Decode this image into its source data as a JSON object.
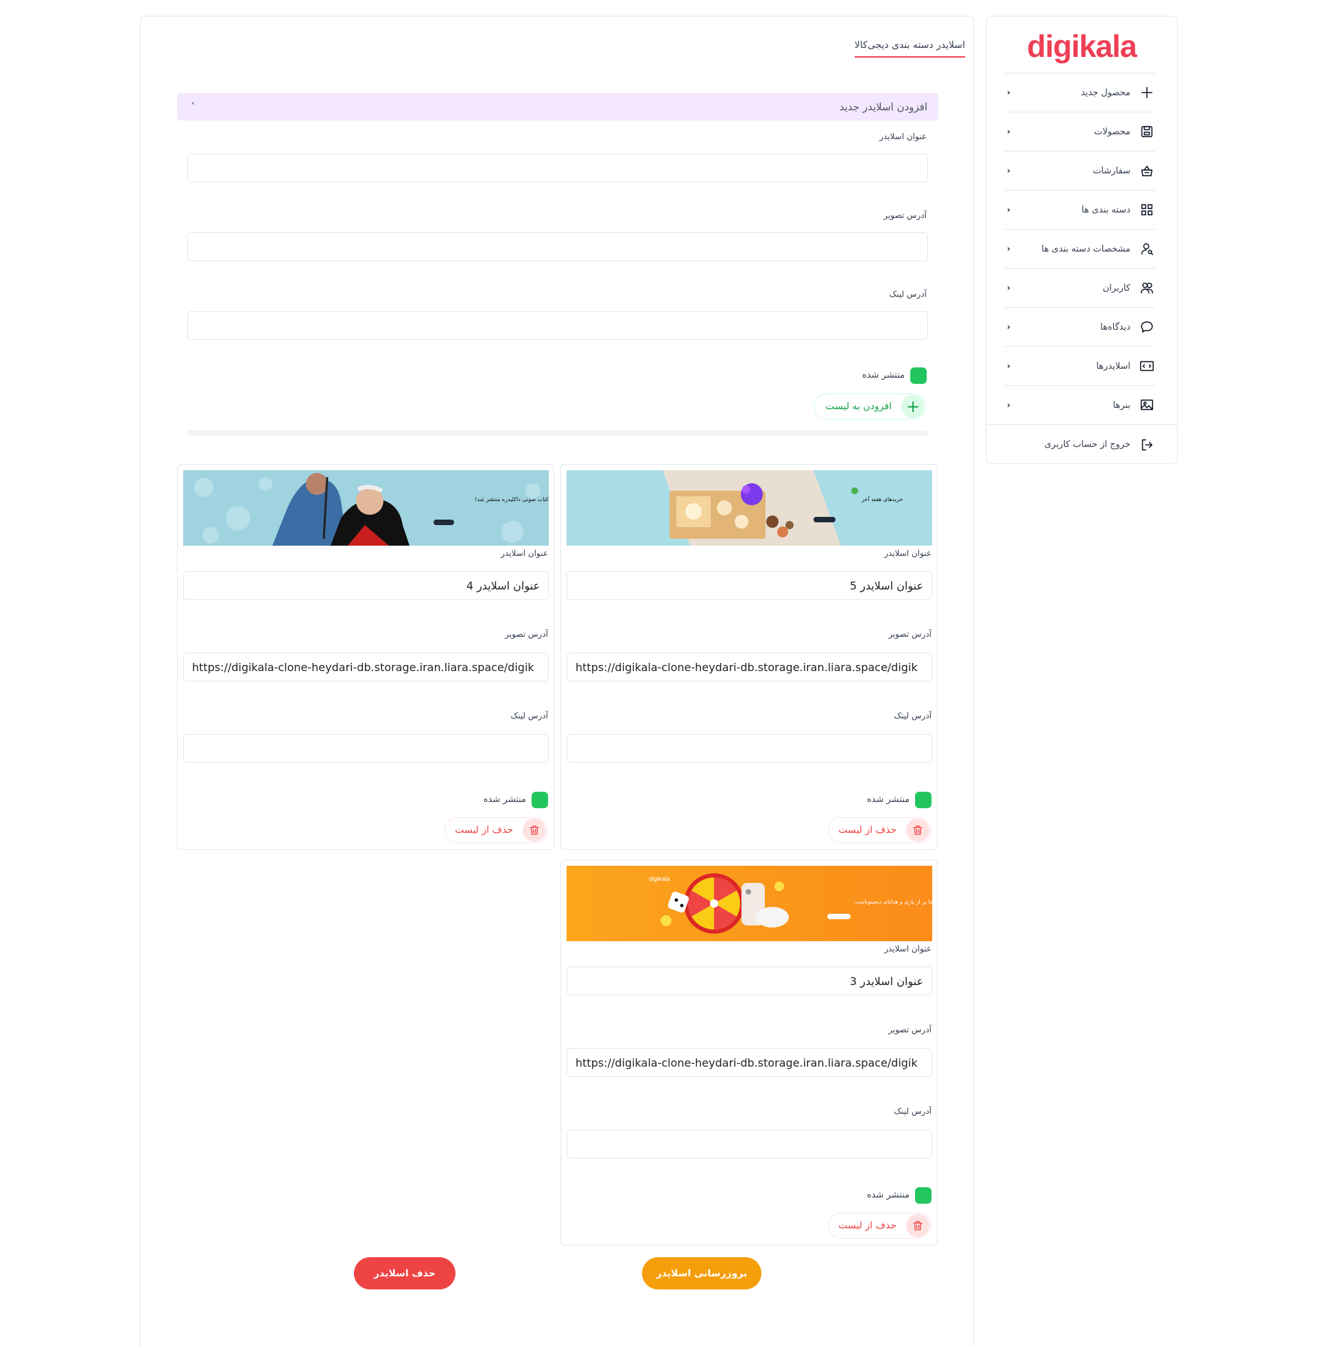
{
  "sidebar": {
    "logo": "digikala",
    "items": [
      {
        "label": "محصول جدید",
        "icon": "plus-icon"
      },
      {
        "label": "محصولات",
        "icon": "save-icon"
      },
      {
        "label": "سفارشات",
        "icon": "basket-icon"
      },
      {
        "label": "دسته بندی ها",
        "icon": "grid-icon"
      },
      {
        "label": "مشخصات دسته بندی ها",
        "icon": "user-search-icon"
      },
      {
        "label": "کاربران",
        "icon": "users-icon"
      },
      {
        "label": "دیدگاه‌ها",
        "icon": "comment-icon"
      },
      {
        "label": "اسلایدرها",
        "icon": "slider-icon"
      },
      {
        "label": "بنرها",
        "icon": "image-icon"
      }
    ],
    "logout": "خروج از حساب کاربری"
  },
  "page": {
    "tab": "اسلایدر دسته بندی دیجی‌کالا"
  },
  "form": {
    "accordion_title": "افزودن اسلایدر جدید",
    "title_label": "عنوان اسلایدر",
    "title_value": "",
    "image_label": "آدرس تصویر",
    "image_value": "",
    "link_label": "آدرس لینک",
    "link_value": "",
    "published_label": "منتشر شده",
    "add_button": "افزودن به لیست"
  },
  "slides": [
    {
      "title_label": "عنوان اسلایدر",
      "title_value": "عنوان اسلایدر 5",
      "image_label": "آدرس تصویر",
      "image_value": "https://digikala-clone-heydari-db.storage.iran.liara.space/digik",
      "link_label": "آدرس لینک",
      "link_value": "",
      "published_label": "منتشر شده",
      "delete_button": "حذف از لیست",
      "banner": {
        "heading": "خریدهای هفته آخر",
        "colors": {
          "bg": "#a8dde6"
        }
      }
    },
    {
      "title_label": "عنوان اسلایدر",
      "title_value": "عنوان اسلایدر 4",
      "image_label": "آدرس تصویر",
      "image_value": "https://digikala-clone-heydari-db.storage.iran.liara.space/digik",
      "link_label": "آدرس لینک",
      "link_value": "",
      "published_label": "منتشر شده",
      "delete_button": "حذف از لیست",
      "banner": {
        "heading": "کتاب صوتی داکلیدره منتشر شد!",
        "colors": {
          "bg": "#9fd3df"
        }
      }
    },
    {
      "title_label": "عنوان اسلایدر",
      "title_value": "عنوان اسلایدر 3",
      "image_label": "آدرس تصویر",
      "image_value": "https://digikala-clone-heydari-db.storage.iran.liara.space/digik",
      "link_label": "آدرس لینک",
      "link_value": "",
      "published_label": "منتشر شده",
      "delete_button": "حذف از لیست",
      "banner": {
        "heading": "اینجا پر از بازی و هدایای دیجیتوناست",
        "colors": {
          "bg": "#fb9a1e"
        }
      }
    }
  ],
  "actions": {
    "update": "بروزرسانی اسلایدر",
    "delete": "حذف اسلایدر"
  },
  "colors": {
    "brand": "#ef4056",
    "accordion_bg": "#f3e8ff",
    "published": "#22c55e",
    "update_btn": "#f59e0b",
    "delete_btn": "#ef4444"
  }
}
